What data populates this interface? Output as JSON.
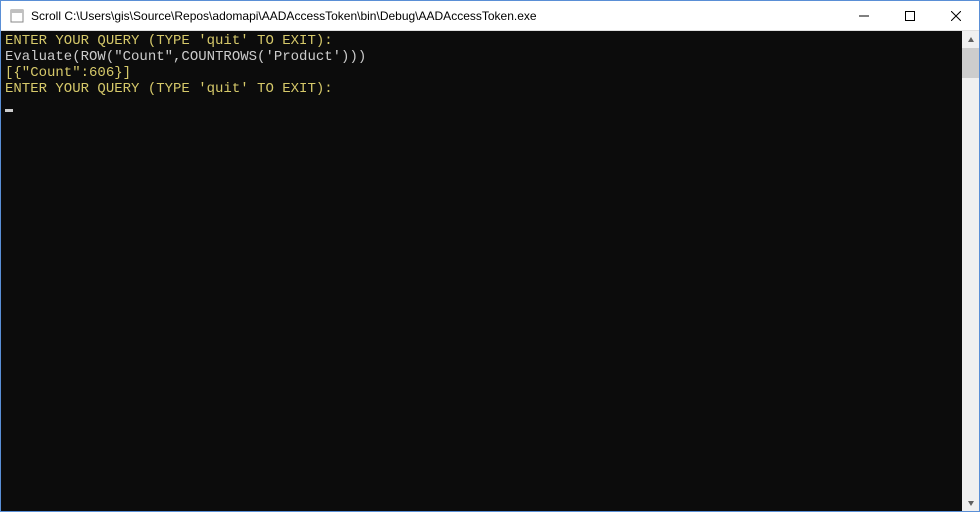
{
  "window": {
    "title": "Scroll C:\\Users\\gis\\Source\\Repos\\adomapi\\AADAccessToken\\bin\\Debug\\AADAccessToken.exe"
  },
  "console": {
    "lines": [
      {
        "cls": "prompt-line",
        "text": "ENTER YOUR QUERY (TYPE 'quit' TO EXIT):"
      },
      {
        "cls": "input-line",
        "text": "Evaluate(ROW(\"Count\",COUNTROWS('Product')))"
      },
      {
        "cls": "result-line",
        "text": "[{\"Count\":606}]"
      },
      {
        "cls": "prompt-line",
        "text": "ENTER YOUR QUERY (TYPE 'quit' TO EXIT):"
      }
    ]
  }
}
